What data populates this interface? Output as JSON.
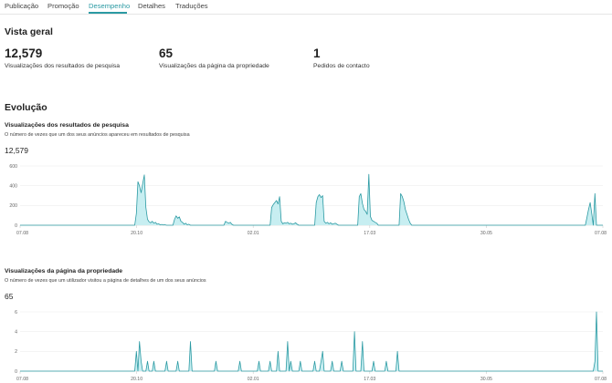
{
  "tabs": [
    {
      "label": "Publicação"
    },
    {
      "label": "Promoção"
    },
    {
      "label": "Desempenho",
      "active": true
    },
    {
      "label": "Detalhes"
    },
    {
      "label": "Traduções"
    }
  ],
  "overview": {
    "title": "Vista geral",
    "metrics": [
      {
        "value": "12,579",
        "label": "Visualizações dos resultados de pesquisa"
      },
      {
        "value": "65",
        "label": "Visualizações da página da propriedade"
      },
      {
        "value": "1",
        "label": "Pedidos de contacto"
      }
    ]
  },
  "evolution": {
    "title": "Evolução"
  },
  "colors": {
    "accent": "#2b9aa3",
    "area_fill": "#c7eef1",
    "grid": "#eeeeee"
  },
  "chart_data": [
    {
      "type": "area",
      "title": "Visualizações dos resultados de pesquisa",
      "subtitle": "O número de vezes que um dos seus anúncios apareceu em resultados de pesquisa",
      "total": "12,579",
      "x_ticks": [
        "07.08",
        "20.10",
        "02.01",
        "17.03",
        "30.05",
        "07.08"
      ],
      "y_ticks": [
        "0",
        "200",
        "400",
        "600"
      ],
      "ylim": [
        0,
        600
      ],
      "x_range": [
        0,
        366
      ],
      "points": [
        [
          0,
          0
        ],
        [
          72,
          0
        ],
        [
          73,
          120
        ],
        [
          74,
          440
        ],
        [
          75,
          400
        ],
        [
          76,
          330
        ],
        [
          77,
          420
        ],
        [
          78,
          510
        ],
        [
          79,
          180
        ],
        [
          80,
          60
        ],
        [
          81,
          35
        ],
        [
          82,
          25
        ],
        [
          83,
          40
        ],
        [
          84,
          20
        ],
        [
          85,
          30
        ],
        [
          86,
          10
        ],
        [
          87,
          15
        ],
        [
          88,
          5
        ],
        [
          89,
          8
        ],
        [
          90,
          3
        ],
        [
          91,
          5
        ],
        [
          92,
          0
        ],
        [
          96,
          0
        ],
        [
          97,
          60
        ],
        [
          98,
          95
        ],
        [
          99,
          70
        ],
        [
          100,
          85
        ],
        [
          101,
          40
        ],
        [
          102,
          30
        ],
        [
          103,
          10
        ],
        [
          104,
          20
        ],
        [
          105,
          5
        ],
        [
          106,
          10
        ],
        [
          107,
          0
        ],
        [
          128,
          0
        ],
        [
          129,
          40
        ],
        [
          130,
          30
        ],
        [
          131,
          20
        ],
        [
          132,
          30
        ],
        [
          133,
          10
        ],
        [
          134,
          0
        ],
        [
          157,
          0
        ],
        [
          158,
          180
        ],
        [
          159,
          210
        ],
        [
          160,
          230
        ],
        [
          161,
          250
        ],
        [
          162,
          215
        ],
        [
          163,
          290
        ],
        [
          164,
          40
        ],
        [
          165,
          15
        ],
        [
          166,
          25
        ],
        [
          167,
          20
        ],
        [
          168,
          30
        ],
        [
          169,
          15
        ],
        [
          170,
          20
        ],
        [
          171,
          10
        ],
        [
          172,
          15
        ],
        [
          173,
          25
        ],
        [
          174,
          10
        ],
        [
          175,
          0
        ],
        [
          185,
          0
        ],
        [
          186,
          230
        ],
        [
          187,
          290
        ],
        [
          188,
          310
        ],
        [
          189,
          280
        ],
        [
          190,
          300
        ],
        [
          191,
          40
        ],
        [
          192,
          20
        ],
        [
          193,
          30
        ],
        [
          194,
          15
        ],
        [
          195,
          25
        ],
        [
          196,
          10
        ],
        [
          197,
          15
        ],
        [
          198,
          20
        ],
        [
          199,
          10
        ],
        [
          200,
          0
        ],
        [
          212,
          0
        ],
        [
          213,
          290
        ],
        [
          214,
          320
        ],
        [
          215,
          220
        ],
        [
          216,
          160
        ],
        [
          217,
          140
        ],
        [
          218,
          110
        ],
        [
          219,
          515
        ],
        [
          220,
          90
        ],
        [
          221,
          50
        ],
        [
          222,
          40
        ],
        [
          223,
          30
        ],
        [
          224,
          20
        ],
        [
          225,
          0
        ],
        [
          238,
          0
        ],
        [
          239,
          320
        ],
        [
          240,
          290
        ],
        [
          241,
          240
        ],
        [
          242,
          160
        ],
        [
          243,
          110
        ],
        [
          244,
          60
        ],
        [
          245,
          20
        ],
        [
          246,
          0
        ],
        [
          355,
          0
        ],
        [
          356,
          80
        ],
        [
          357,
          160
        ],
        [
          358,
          230
        ],
        [
          359,
          120
        ],
        [
          360,
          0
        ],
        [
          361,
          320
        ],
        [
          362,
          0
        ],
        [
          366,
          0
        ]
      ]
    },
    {
      "type": "area",
      "title": "Visualizações da página da propriedade",
      "subtitle": "O número de vezes que um utilizador visitou a página de detalhes de um dos seus anúncios",
      "total": "65",
      "x_ticks": [
        "07.08",
        "20.10",
        "02.01",
        "17.03",
        "30.05",
        "07.08"
      ],
      "y_ticks": [
        "0",
        "2",
        "4",
        "6"
      ],
      "ylim": [
        0,
        6
      ],
      "x_range": [
        0,
        366
      ],
      "points": [
        [
          0,
          0
        ],
        [
          72,
          0
        ],
        [
          73,
          2
        ],
        [
          74,
          0
        ],
        [
          75,
          3
        ],
        [
          76,
          1
        ],
        [
          77,
          0
        ],
        [
          79,
          0
        ],
        [
          80,
          1
        ],
        [
          81,
          0
        ],
        [
          83,
          0
        ],
        [
          84,
          1
        ],
        [
          85,
          0
        ],
        [
          91,
          0
        ],
        [
          92,
          1
        ],
        [
          93,
          0
        ],
        [
          98,
          0
        ],
        [
          99,
          1
        ],
        [
          100,
          0
        ],
        [
          106,
          0
        ],
        [
          107,
          3
        ],
        [
          108,
          0
        ],
        [
          122,
          0
        ],
        [
          123,
          1
        ],
        [
          124,
          0
        ],
        [
          137,
          0
        ],
        [
          138,
          1
        ],
        [
          139,
          0
        ],
        [
          149,
          0
        ],
        [
          150,
          1
        ],
        [
          151,
          0
        ],
        [
          156,
          0
        ],
        [
          157,
          1
        ],
        [
          158,
          0
        ],
        [
          161,
          0
        ],
        [
          162,
          2
        ],
        [
          163,
          0
        ],
        [
          167,
          0
        ],
        [
          168,
          3
        ],
        [
          169,
          0
        ],
        [
          170,
          1
        ],
        [
          171,
          0
        ],
        [
          175,
          0
        ],
        [
          176,
          1
        ],
        [
          177,
          0
        ],
        [
          184,
          0
        ],
        [
          185,
          1
        ],
        [
          186,
          0
        ],
        [
          188,
          0
        ],
        [
          189,
          1
        ],
        [
          190,
          2
        ],
        [
          191,
          0
        ],
        [
          195,
          0
        ],
        [
          196,
          1
        ],
        [
          197,
          0
        ],
        [
          201,
          0
        ],
        [
          202,
          1
        ],
        [
          203,
          0
        ],
        [
          209,
          0
        ],
        [
          210,
          4
        ],
        [
          211,
          0
        ],
        [
          214,
          0
        ],
        [
          215,
          3
        ],
        [
          216,
          0
        ],
        [
          221,
          0
        ],
        [
          222,
          1
        ],
        [
          223,
          0
        ],
        [
          229,
          0
        ],
        [
          230,
          1
        ],
        [
          231,
          0
        ],
        [
          236,
          0
        ],
        [
          237,
          2
        ],
        [
          238,
          0
        ],
        [
          360,
          0
        ],
        [
          361,
          1
        ],
        [
          362,
          6
        ],
        [
          363,
          0
        ],
        [
          366,
          0
        ]
      ]
    }
  ]
}
